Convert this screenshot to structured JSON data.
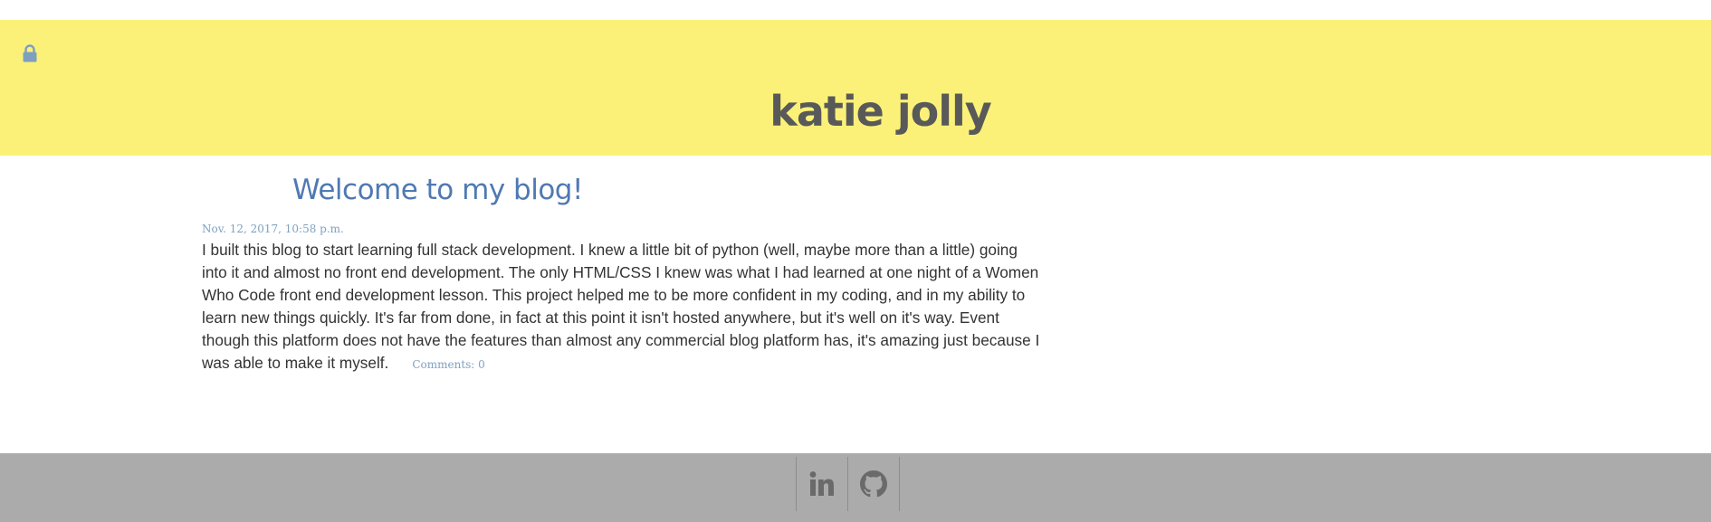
{
  "header": {
    "title": "katie jolly",
    "lock_icon": "lock-icon",
    "background_color": "#fbf179",
    "title_color": "#595959"
  },
  "post": {
    "title": "Welcome to my blog!",
    "date": "Nov. 12, 2017, 10:58 p.m.",
    "body": "I built this blog to start learning full stack development. I knew a little bit of python (well, maybe more than a little) going into it and almost no front end development. The only HTML/CSS I knew was what I had learned at one night of a Women Who Code front end development lesson. This project helped me to be more confident in my coding, and in my ability to learn new things quickly. It's far from done, in fact at this point it isn't hosted anywhere, but it's well on it's way. Event though this platform does not have the features than almost any commercial blog platform has, it's amazing just because I was able to make it myself.",
    "comments_label": "Comments: 0",
    "title_color": "#4f79b3",
    "meta_color": "#7fa1c2"
  },
  "footer": {
    "background_color": "#ababab",
    "icons": [
      "linkedin-icon",
      "github-icon"
    ]
  }
}
